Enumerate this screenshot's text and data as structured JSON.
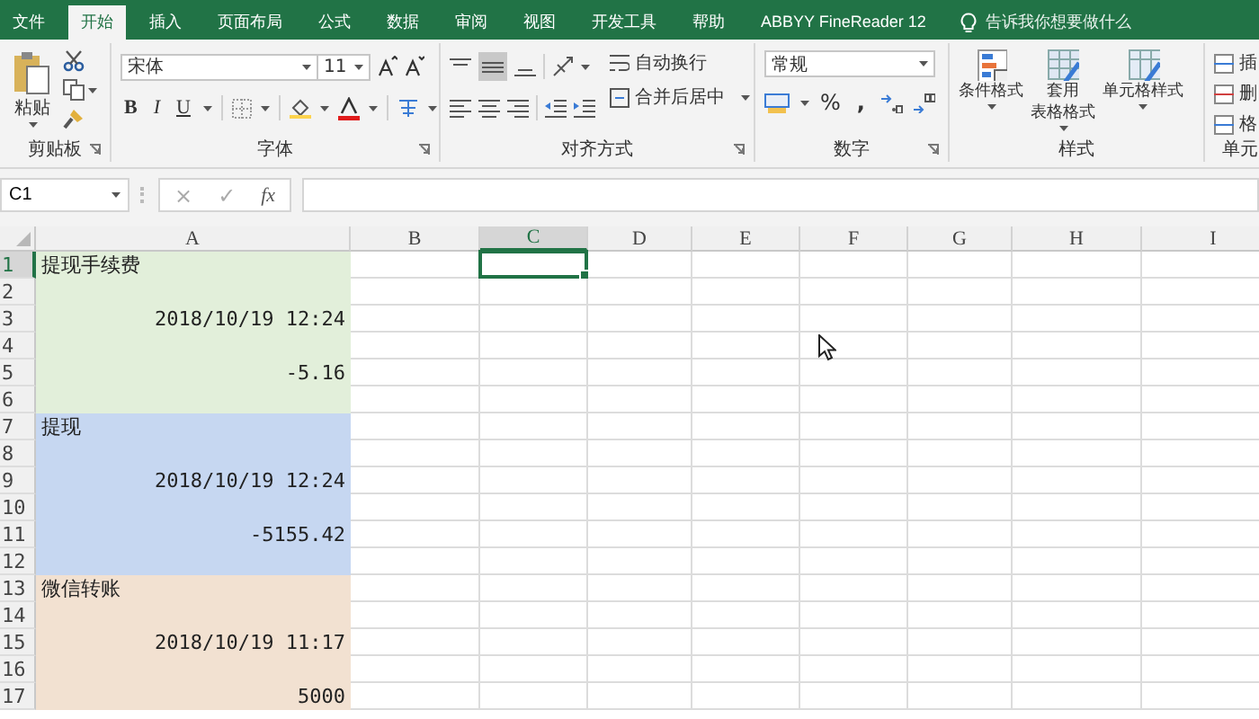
{
  "tabs": [
    {
      "label": "文件",
      "selected": false
    },
    {
      "label": "开始",
      "selected": true
    },
    {
      "label": "插入",
      "selected": false
    },
    {
      "label": "页面布局",
      "selected": false
    },
    {
      "label": "公式",
      "selected": false
    },
    {
      "label": "数据",
      "selected": false
    },
    {
      "label": "审阅",
      "selected": false
    },
    {
      "label": "视图",
      "selected": false
    },
    {
      "label": "开发工具",
      "selected": false
    },
    {
      "label": "帮助",
      "selected": false
    },
    {
      "label": "ABBYY FineReader 12",
      "selected": false
    }
  ],
  "tell_me": {
    "placeholder": "告诉我你想要做什么"
  },
  "ribbon": {
    "clipboard": {
      "label": "剪贴板",
      "paste": "粘贴"
    },
    "font": {
      "label": "字体",
      "name": "宋体",
      "size": "11",
      "bold": "B",
      "italic": "I",
      "underline": "U"
    },
    "alignment": {
      "label": "对齐方式",
      "wrap": "自动换行",
      "merge": "合并后居中"
    },
    "number": {
      "label": "数字",
      "format": "常规",
      "percent": "%",
      "comma": ","
    },
    "styles": {
      "label": "样式",
      "buttons": [
        {
          "lines": [
            "条件格式"
          ]
        },
        {
          "lines": [
            "套用",
            "表格格式"
          ]
        },
        {
          "lines": [
            "单元格样式"
          ]
        }
      ]
    },
    "cells": {
      "label": "单元",
      "buttons": [
        "插",
        "删",
        "格"
      ]
    }
  },
  "formula_bar": {
    "name_box": "C1",
    "cancel": "×",
    "enter": "✓",
    "function": "fx"
  },
  "sheet": {
    "columns": [
      {
        "label": "A",
        "selected": false
      },
      {
        "label": "B",
        "selected": false
      },
      {
        "label": "C",
        "selected": true
      },
      {
        "label": "D",
        "selected": false
      },
      {
        "label": "E",
        "selected": false
      },
      {
        "label": "F",
        "selected": false
      },
      {
        "label": "G",
        "selected": false
      },
      {
        "label": "H",
        "selected": false
      },
      {
        "label": "I",
        "selected": false
      }
    ],
    "rows": [
      {
        "header": "1",
        "selected": true,
        "color": "#e2efda",
        "cell_a": {
          "value": "提现手续费",
          "kind": "text"
        }
      },
      {
        "header": "2",
        "selected": false,
        "color": "#e2efda"
      },
      {
        "header": "3",
        "selected": false,
        "color": "#e2efda",
        "cell_a": {
          "value": "2018/10/19 12:24",
          "kind": "number"
        }
      },
      {
        "header": "4",
        "selected": false,
        "color": "#e2efda"
      },
      {
        "header": "5",
        "selected": false,
        "color": "#e2efda",
        "cell_a": {
          "value": "-5.16",
          "kind": "number"
        }
      },
      {
        "header": "6",
        "selected": false,
        "color": "#e2efda"
      },
      {
        "header": "7",
        "selected": false,
        "color": "#c6d7f1",
        "cell_a": {
          "value": "提现",
          "kind": "text"
        }
      },
      {
        "header": "8",
        "selected": false,
        "color": "#c6d7f1"
      },
      {
        "header": "9",
        "selected": false,
        "color": "#c6d7f1",
        "cell_a": {
          "value": "2018/10/19 12:24",
          "kind": "number"
        }
      },
      {
        "header": "10",
        "selected": false,
        "color": "#c6d7f1"
      },
      {
        "header": "11",
        "selected": false,
        "color": "#c6d7f1",
        "cell_a": {
          "value": "-5155.42",
          "kind": "number"
        }
      },
      {
        "header": "12",
        "selected": false,
        "color": "#c6d7f1"
      },
      {
        "header": "13",
        "selected": false,
        "color": "#f2e1d1",
        "cell_a": {
          "value": "微信转账",
          "kind": "text"
        }
      },
      {
        "header": "14",
        "selected": false,
        "color": "#f2e1d1"
      },
      {
        "header": "15",
        "selected": false,
        "color": "#f2e1d1",
        "cell_a": {
          "value": "2018/10/19 11:17",
          "kind": "number"
        }
      },
      {
        "header": "16",
        "selected": false,
        "color": "#f2e1d1"
      },
      {
        "header": "17",
        "selected": false,
        "color": "#f2e1d1",
        "cell_a": {
          "value": "5000",
          "kind": "number"
        }
      }
    ]
  }
}
